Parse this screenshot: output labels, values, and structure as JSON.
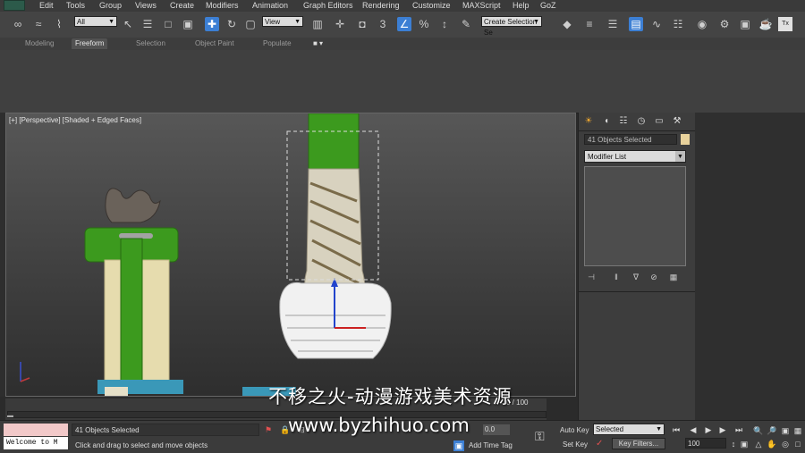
{
  "menu": {
    "items": [
      "Edit",
      "Tools",
      "Group",
      "Views",
      "Create",
      "Modifiers",
      "Animation",
      "Graph Editors",
      "Rendering",
      "Customize",
      "MAXScript",
      "Help",
      "GoZ"
    ]
  },
  "toolbar": {
    "filter_value": "All",
    "view_value": "View",
    "selection_set_value": "Create Selection Se",
    "snap_label": "3",
    "active_color": "#3c7fd4"
  },
  "ribbon": {
    "tabs": [
      "Modeling",
      "Freeform",
      "Selection",
      "Object Paint",
      "Populate"
    ],
    "active_tab": "Freeform"
  },
  "viewport": {
    "label": "[+] [Perspective] [Shaded + Edged Faces]"
  },
  "command_panel": {
    "object_name": "41 Objects Selected",
    "modifier_list_value": "Modifier List",
    "object_color": "#e8d29c"
  },
  "timeline": {
    "counter": "0 / 100"
  },
  "status": {
    "welcome_text": "Welcome to M",
    "selection_text": "41 Objects Selected",
    "prompt_text": "Click and drag to select and move objects",
    "coord_value": "0.0",
    "add_time_tag": "Add Time Tag",
    "auto_key": "Auto Key",
    "set_key": "Set Key",
    "key_mode": "Selected",
    "key_filters": "Key Filters...",
    "current_frame": "100"
  },
  "watermark": {
    "line1": "不移之火-动漫游戏美术资源",
    "line2": "www.byzhihuo.com"
  }
}
